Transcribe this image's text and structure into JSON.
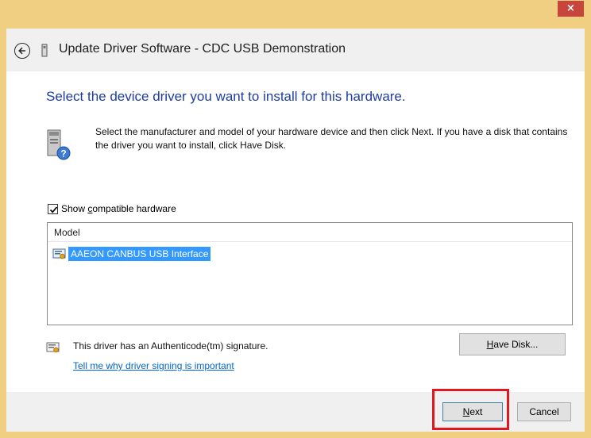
{
  "window": {
    "close_label": "×",
    "accent_color": "#f0cf83"
  },
  "header": {
    "title": "Update Driver Software - CDC USB Demonstration",
    "back_icon": "back-arrow-icon",
    "device_icon": "usb-device-icon"
  },
  "main": {
    "heading": "Select the device driver you want to install for this hardware.",
    "description": "Select the manufacturer and model of your hardware device and then click Next. If you have a disk that contains the driver you want to install, click Have Disk.",
    "hardware_icon": "hardware-help-icon",
    "show_compatible": {
      "checked": true,
      "label_pre": "Show ",
      "label_accel": "c",
      "label_post": "ompatible hardware"
    },
    "model_list": {
      "header": "Model",
      "items": [
        {
          "label": "AAEON CANBUS USB Interface",
          "selected": true
        }
      ]
    },
    "signature_text": "This driver has an Authenticode(tm) signature.",
    "signature_link": "Tell me why driver signing is important",
    "have_disk": {
      "accel": "H",
      "rest": "ave Disk..."
    }
  },
  "footer": {
    "next": {
      "accel": "N",
      "rest": "ext"
    },
    "cancel_label": "Cancel",
    "highlight_color": "#e0171f"
  }
}
